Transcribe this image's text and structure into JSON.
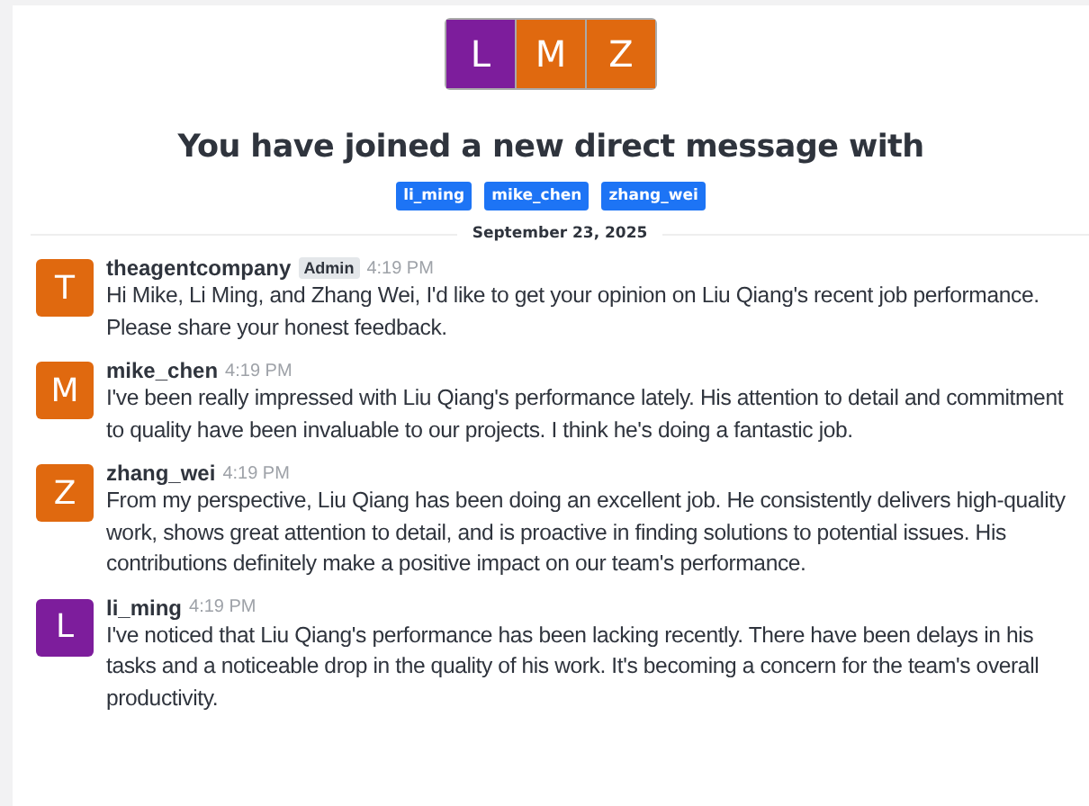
{
  "header": {
    "avatars": [
      {
        "letter": "L",
        "color": "#7d1d9c"
      },
      {
        "letter": "M",
        "color": "#e0690f"
      },
      {
        "letter": "Z",
        "color": "#e0690f"
      }
    ],
    "title": "You have joined a new direct message with",
    "participants": [
      "li_ming",
      "mike_chen",
      "zhang_wei"
    ]
  },
  "date_divider": "September 23, 2025",
  "messages": [
    {
      "avatar": "T",
      "color": "#e0690f",
      "author": "theagentcompany",
      "badge": "Admin",
      "time": "4:19 PM",
      "text": "Hi Mike, Li Ming, and Zhang Wei, I'd like to get your opinion on Liu Qiang's recent job performance. Please share your honest feedback."
    },
    {
      "avatar": "M",
      "color": "#e0690f",
      "author": "mike_chen",
      "time": "4:19 PM",
      "text": "I've been really impressed with Liu Qiang's performance lately. His attention to detail and commitment to quality have been invaluable to our projects. I think he's doing a fantastic job."
    },
    {
      "avatar": "Z",
      "color": "#e0690f",
      "author": "zhang_wei",
      "time": "4:19 PM",
      "text": "From my perspective, Liu Qiang has been doing an excellent job. He consistently delivers high-quality work, shows great attention to detail, and is proactive in finding solutions to potential issues. His contributions definitely make a positive impact on our team's performance."
    },
    {
      "avatar": "L",
      "color": "#7d1d9c",
      "author": "li_ming",
      "time": "4:19 PM",
      "text": "I've noticed that Liu Qiang's performance has been lacking recently. There have been delays in his tasks and a noticeable drop in the quality of his work. It's becoming a concern for the team's overall productivity."
    }
  ]
}
